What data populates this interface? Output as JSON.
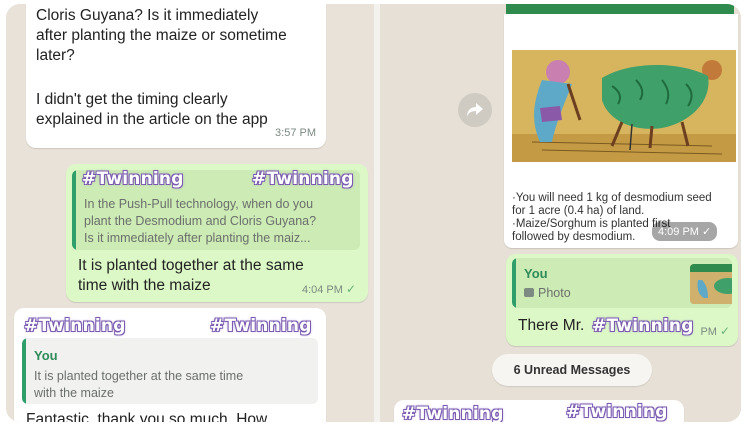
{
  "watermark": "#Twinning",
  "left_chat": {
    "incoming_1": {
      "lines": [
        "Cloris Guyana? Is it immediately",
        "after planting the maize or sometime",
        "later?"
      ],
      "followup_lines": [
        "I didn't get the timing clearly",
        "explained in the article on the app"
      ],
      "time": "3:57 PM"
    },
    "outgoing_reply": {
      "quote_lines": [
        "In the Push-Pull technology, when do you",
        "plant the Desmodium and Cloris Guyana?",
        "Is it immediately after planting the maiz..."
      ],
      "lines": [
        "It is planted together at the same",
        "time with the maize"
      ],
      "time": "4:04 PM"
    },
    "incoming_2": {
      "quote_author": "You",
      "quote_lines": [
        "It is planted together at the same time",
        "with the maize"
      ],
      "text": "Fantastic, thank you so much. How"
    }
  },
  "right_chat": {
    "image_message": {
      "caption_lines": [
        "·You will need 1 kg of desmodium seed",
        "for 1 acre (0.4 ha) of land.",
        "·Maize/Sorghum is planted first",
        "followed by desmodium."
      ],
      "time": "4:09 PM"
    },
    "reply_message": {
      "quote_author": "You",
      "quote_media": "Photo",
      "text": "There Mr.",
      "time_suffix": "PM"
    },
    "unread_label": "6 Unread Messages"
  },
  "icons": [
    "share-forward-icon",
    "read-check-icon",
    "photo-icon"
  ],
  "colors": {
    "outgoing": "#dcf8c6",
    "incoming": "#ffffff",
    "accent": "#2e9e6a",
    "watermark": "#7a5bb0"
  }
}
